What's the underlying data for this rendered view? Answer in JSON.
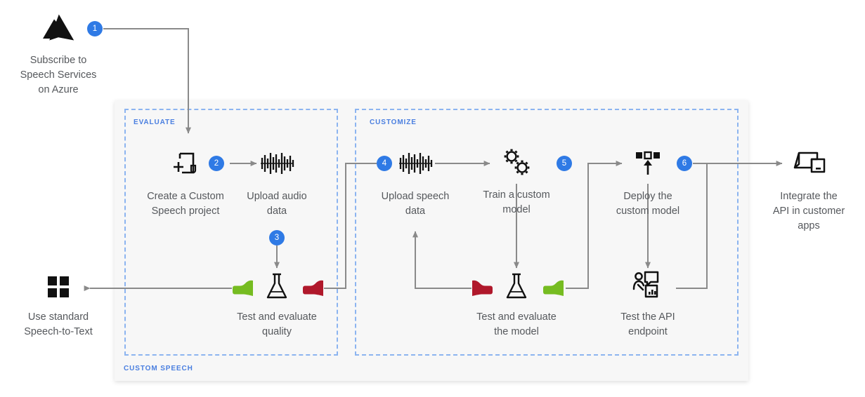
{
  "diagram": {
    "title_zones": {
      "evaluate": "EVALUATE",
      "customize": "CUSTOMIZE",
      "custom_speech": "CUSTOM SPEECH"
    },
    "colors": {
      "accent_blue": "#2f7ae5",
      "zone_label_blue": "#4a7fe0",
      "dashed_border": "#8cb4f0",
      "card_bg": "#f7f7f7",
      "connector_gray": "#8a8a8a",
      "text_gray": "#55585c",
      "thumb_up_green": "#76bc21",
      "thumb_down_red": "#b0182b",
      "icon_black": "#111111"
    }
  },
  "nodes": [
    {
      "id": "subscribe",
      "icon": "azure-logo-icon",
      "label": "Subscribe to\nSpeech Services\non Azure"
    },
    {
      "id": "create-project",
      "icon": "new-document-plus-icon",
      "label": "Create a Custom\nSpeech project"
    },
    {
      "id": "upload-audio",
      "icon": "audio-waveform-icon",
      "label": "Upload audio\ndata"
    },
    {
      "id": "test-quality",
      "icon": "flask-icon",
      "label": "Test and evaluate\nquality"
    },
    {
      "id": "use-standard",
      "icon": "four-squares-icon",
      "label": "Use standard\nSpeech-to-Text"
    },
    {
      "id": "upload-speech",
      "icon": "audio-waveform-icon",
      "label": "Upload speech\ndata"
    },
    {
      "id": "train-model",
      "icon": "gears-icon",
      "label": "Train a custom\nmodel"
    },
    {
      "id": "test-model",
      "icon": "flask-icon",
      "label": "Test and evaluate\nthe model"
    },
    {
      "id": "deploy-model",
      "icon": "deploy-upload-icon",
      "label": "Deploy the\ncustom model"
    },
    {
      "id": "test-endpoint",
      "icon": "user-endpoint-icon",
      "label": "Test the API\nendpoint"
    },
    {
      "id": "integrate-api",
      "icon": "devices-icon",
      "label": "Integrate the\nAPI in customer\napps"
    }
  ],
  "steps": [
    {
      "number": "1",
      "for": "subscribe"
    },
    {
      "number": "2",
      "for": "upload-audio"
    },
    {
      "number": "3",
      "for": "test-quality"
    },
    {
      "number": "4",
      "for": "upload-speech"
    },
    {
      "number": "5",
      "for": "deploy-model"
    },
    {
      "number": "6",
      "for": "integrate-api"
    }
  ],
  "verdicts": [
    {
      "id": "quality-pass",
      "icon": "thumbs-up-icon",
      "meaning": "pass"
    },
    {
      "id": "quality-fail",
      "icon": "thumbs-down-icon",
      "meaning": "fail"
    },
    {
      "id": "model-fail",
      "icon": "thumbs-down-icon",
      "meaning": "fail"
    },
    {
      "id": "model-pass",
      "icon": "thumbs-up-icon",
      "meaning": "pass"
    }
  ]
}
